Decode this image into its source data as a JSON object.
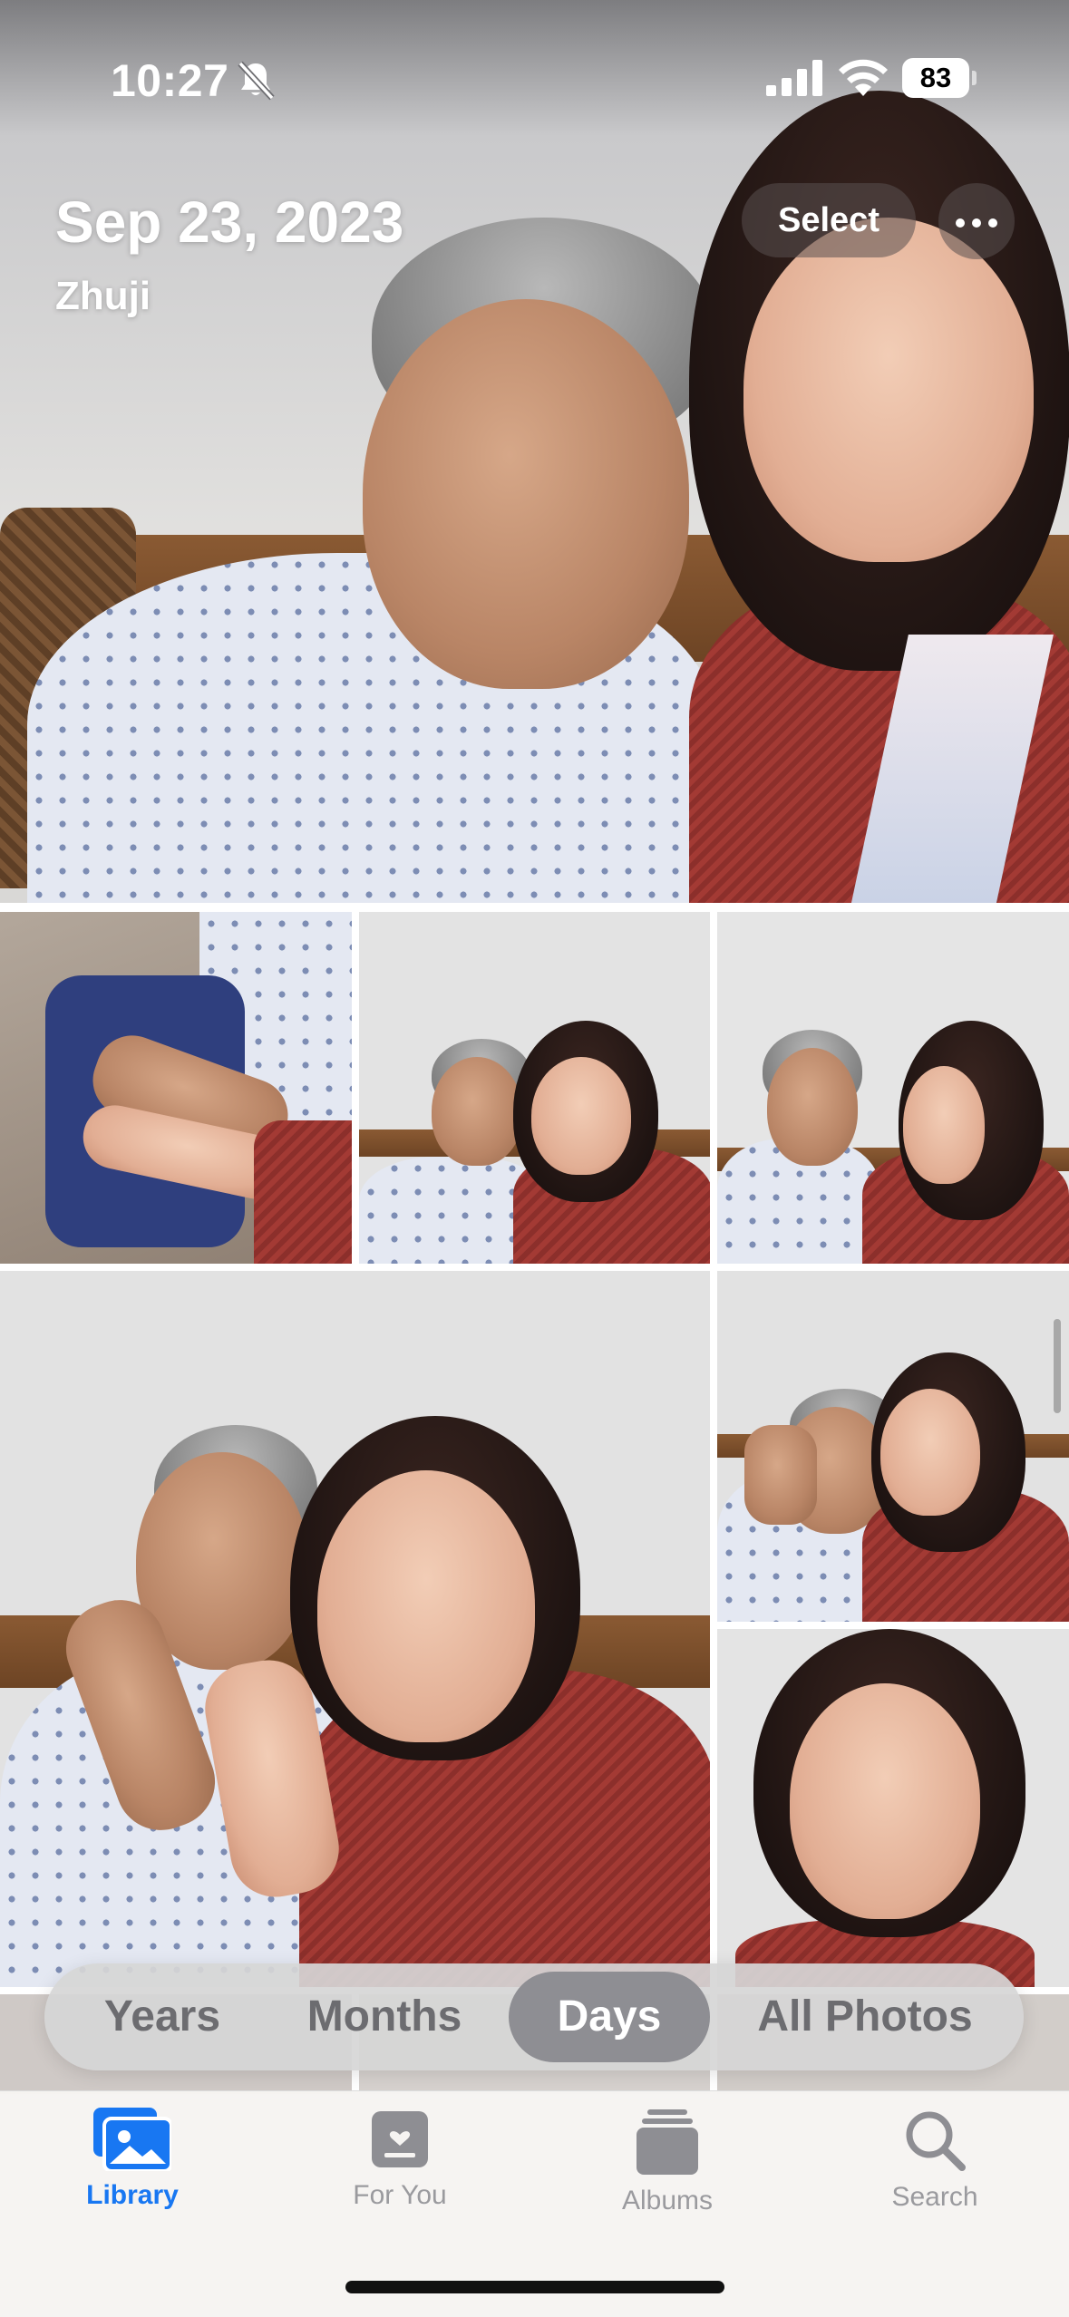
{
  "status_bar": {
    "time": "10:27",
    "battery_level": "83"
  },
  "header": {
    "date": "Sep 23, 2023",
    "location": "Zhuji",
    "select_label": "Select"
  },
  "segmented_control": {
    "options": [
      "Years",
      "Months",
      "Days",
      "All Photos"
    ],
    "selected": "Days"
  },
  "tab_bar": {
    "tabs": [
      {
        "label": "Library",
        "icon": "photo-library-icon",
        "active": true
      },
      {
        "label": "For You",
        "icon": "for-you-icon",
        "active": false
      },
      {
        "label": "Albums",
        "icon": "albums-icon",
        "active": false
      },
      {
        "label": "Search",
        "icon": "search-icon",
        "active": false
      }
    ]
  },
  "colors": {
    "accent": "#1877f2",
    "inactive": "#9a9a9e",
    "segment_active": "#8e8e93"
  }
}
